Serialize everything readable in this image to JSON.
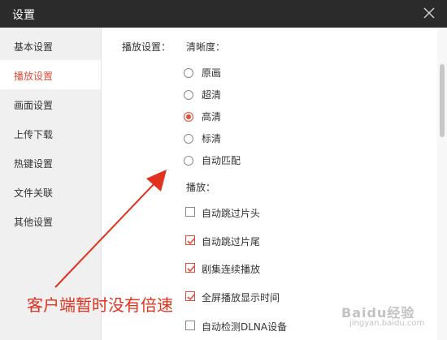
{
  "window": {
    "title": "设置"
  },
  "sidebar": {
    "items": [
      {
        "label": "基本设置",
        "active": false
      },
      {
        "label": "播放设置",
        "active": true
      },
      {
        "label": "画面设置",
        "active": false
      },
      {
        "label": "上传下载",
        "active": false
      },
      {
        "label": "热键设置",
        "active": false
      },
      {
        "label": "文件关联",
        "active": false
      },
      {
        "label": "其他设置",
        "active": false
      }
    ]
  },
  "main": {
    "section_title": "播放设置：",
    "clarity": {
      "label": "清晰度：",
      "options": [
        {
          "label": "原画",
          "selected": false
        },
        {
          "label": "超清",
          "selected": false
        },
        {
          "label": "高清",
          "selected": true
        },
        {
          "label": "标清",
          "selected": false
        },
        {
          "label": "自动匹配",
          "selected": false
        }
      ]
    },
    "playback": {
      "label": "播放：",
      "options": [
        {
          "label": "自动跳过片头",
          "checked": false
        },
        {
          "label": "自动跳过片尾",
          "checked": true
        },
        {
          "label": "剧集连续播放",
          "checked": true
        },
        {
          "label": "全屏播放显示时间",
          "checked": true
        },
        {
          "label": "自动检测DLNA设备",
          "checked": false
        }
      ]
    }
  },
  "annotation": {
    "text": "客户端暂时没有倍速"
  },
  "watermark": {
    "text": "Baidu经验",
    "sub": "jingyan.baidu.com"
  },
  "colors": {
    "accent": "#e04e3f",
    "titlebar": "#2b2b2b",
    "annotation": "#e0321e"
  }
}
